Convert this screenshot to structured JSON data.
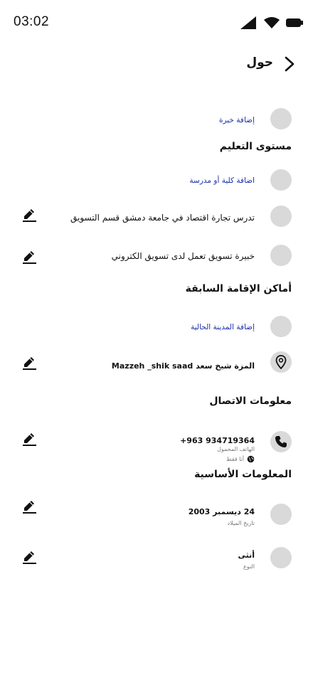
{
  "status_bar": {
    "time": "03:02"
  },
  "header": {
    "title": "حول"
  },
  "work": {
    "add_label": "إضافة خبرة"
  },
  "education": {
    "title": "مستوى التعليم",
    "add_label": "اضافة كلية أو مدرسة",
    "items": [
      {
        "text": "تدرس تجارة اقتصاد في جامعة دمشق قسم التسويق"
      },
      {
        "text": "خبيرة تسويق تعمل لدى تسويق الكتروني"
      }
    ]
  },
  "places": {
    "title": "أماكن الإقامة السابقة",
    "add_label": "إضافة المدينة الحالية",
    "current": "المزة شيخ سعد   Mazzeh _shik saad"
  },
  "contact": {
    "title": "معلومات الاتصال",
    "phone": "+963 934719364",
    "phone_label": "الهاتف المحمول",
    "privacy": "أنا فقط"
  },
  "basic": {
    "title": "المعلومات الأساسية",
    "birthday": "24 ديسمبر 2003",
    "birthday_label": "تاريخ الميلاد",
    "gender": "أنثى",
    "gender_label": "النوع"
  }
}
